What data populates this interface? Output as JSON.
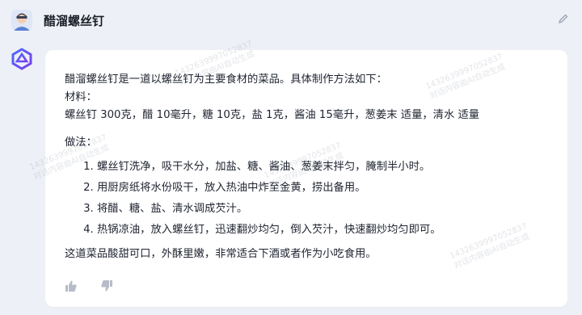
{
  "header": {
    "user_prompt": "醋溜螺丝钉",
    "avatar_icon": "user-avatar-icon",
    "edit_icon": "pencil-icon"
  },
  "assistant": {
    "logo_icon": "assistant-logo-icon",
    "intro": "醋溜螺丝钉是一道以螺丝钉为主要食材的菜品。具体制作方法如下：",
    "materials_label": "材料：",
    "materials": "螺丝钉 300克，醋 10毫升，糖 10克，盐 1克，酱油 15毫升，葱姜末 适量，清水 适量",
    "method_label": "做法：",
    "steps": [
      "螺丝钉洗净，吸干水分，加盐、糖、酱油、葱姜末拌匀，腌制半小时。",
      "用厨房纸将水份吸干，放入热油中炸至金黄，捞出备用。",
      "将醋、糖、盐、清水调成芡汁。",
      "热锅凉油，放入螺丝钉，迅速翻炒均匀，倒入芡汁，快速翻炒均匀即可。"
    ],
    "conclusion": "这道菜品酸甜可口，外酥里嫩，非常适合下酒或者作为小吃食用。",
    "actions": [
      "thumbs-up-icon",
      "thumbs-down-icon"
    ]
  },
  "watermark": {
    "line1": "14326399970​52837",
    "line2": "对话内容由AI自动生成"
  }
}
